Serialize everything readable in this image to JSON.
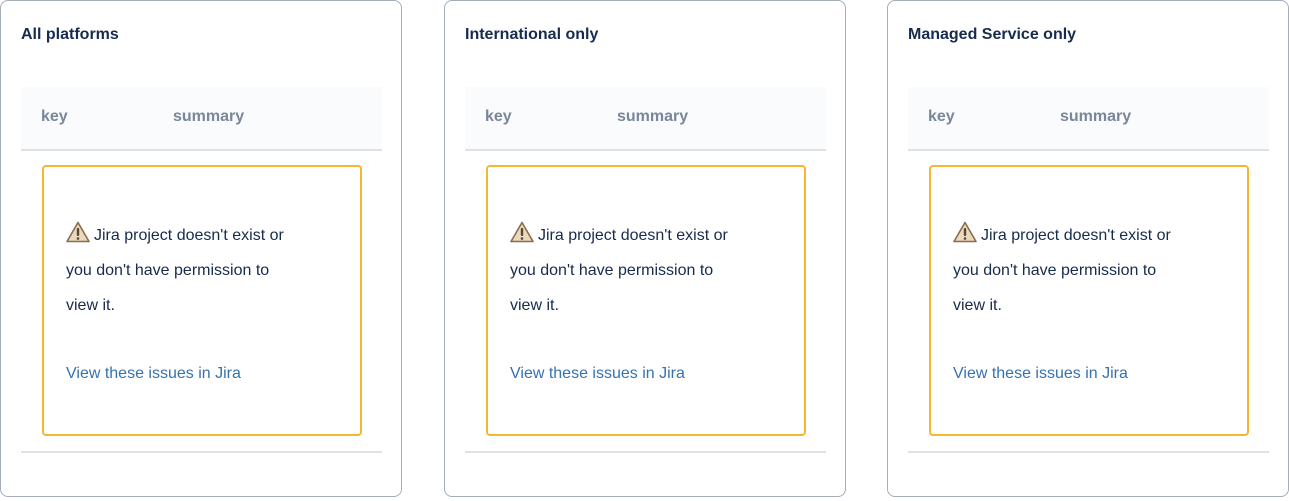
{
  "panels": [
    {
      "title": "All platforms",
      "columns": {
        "key": "key",
        "summary": "summary"
      },
      "message": "Jira project doesn't exist or you don't have permission to view it.",
      "link": "View these issues in Jira"
    },
    {
      "title": "International only",
      "columns": {
        "key": "key",
        "summary": "summary"
      },
      "message": "Jira project doesn't exist or you don't have permission to view it.",
      "link": "View these issues in Jira"
    },
    {
      "title": "Managed Service only",
      "columns": {
        "key": "key",
        "summary": "summary"
      },
      "message": "Jira project doesn't exist or you don't have permission to view it.",
      "link": "View these issues in Jira"
    }
  ],
  "icons": {
    "alert": "warning-icon"
  },
  "colors": {
    "alert_border": "#f5b731",
    "link": "#3572b0",
    "header_text": "#7a869a",
    "body_text": "#172b4d"
  }
}
